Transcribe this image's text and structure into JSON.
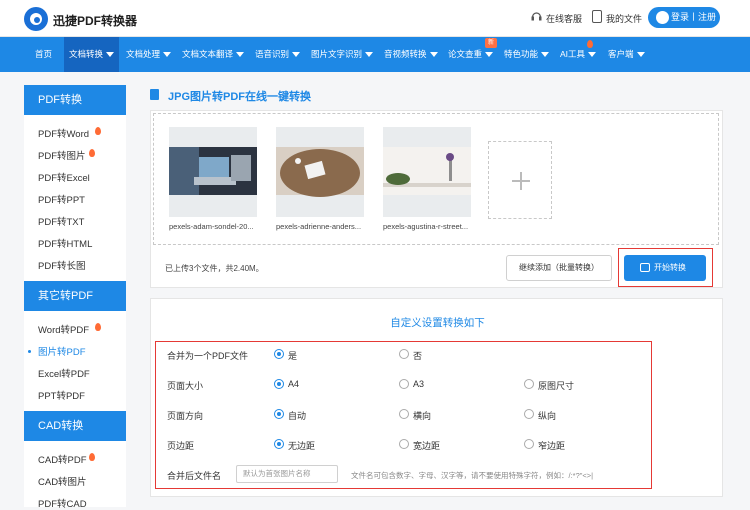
{
  "header": {
    "brand": "迅捷PDF转换器",
    "service": "在线客服",
    "my_files": "我的文件",
    "login": "登录丨注册"
  },
  "nav": {
    "items": [
      {
        "label": "首页",
        "caret": false
      },
      {
        "label": "文档转换",
        "caret": true
      },
      {
        "label": "文档处理",
        "caret": true
      },
      {
        "label": "文档文本翻译",
        "caret": true
      },
      {
        "label": "语音识别",
        "caret": true
      },
      {
        "label": "图片文字识别",
        "caret": true
      },
      {
        "label": "音视频转换",
        "caret": true
      },
      {
        "label": "论文查重",
        "caret": true
      },
      {
        "label": "特色功能",
        "caret": true
      },
      {
        "label": "AI工具",
        "caret": true
      },
      {
        "label": "客户端",
        "caret": true
      }
    ],
    "new_badge": "新"
  },
  "sidebar": {
    "sections": [
      {
        "title": "PDF转换",
        "items": [
          "PDF转Word",
          "PDF转图片",
          "PDF转Excel",
          "PDF转PPT",
          "PDF转TXT",
          "PDF转HTML",
          "PDF转长图"
        ]
      },
      {
        "title": "其它转PDF",
        "items": [
          "Word转PDF",
          "图片转PDF",
          "Excel转PDF",
          "PPT转PDF"
        ]
      },
      {
        "title": "CAD转换",
        "items": [
          "CAD转PDF",
          "CAD转图片",
          "PDF转CAD"
        ]
      }
    ]
  },
  "page": {
    "title": "JPG图片转PDF在线一键转换"
  },
  "upload": {
    "files": [
      {
        "name": "pexels-adam-sondel-20..."
      },
      {
        "name": "pexels-adrienne-anders..."
      },
      {
        "name": "pexels-agustina-r-street..."
      }
    ],
    "status": "已上传3个文件，共2.40M。",
    "add_more": "继续添加（批量转换）",
    "start": "开始转换"
  },
  "settings": {
    "title": "自定义设置转换如下",
    "rows": [
      {
        "label": "合并为一个PDF文件",
        "options": [
          "是",
          "否"
        ],
        "selected": 0
      },
      {
        "label": "页面大小",
        "options": [
          "A4",
          "A3",
          "原图尺寸"
        ],
        "selected": 0
      },
      {
        "label": "页面方向",
        "options": [
          "自动",
          "横向",
          "纵向"
        ],
        "selected": 0
      },
      {
        "label": "页边距",
        "options": [
          "无边距",
          "宽边距",
          "窄边距"
        ],
        "selected": 0
      }
    ],
    "filename_label": "合并后文件名",
    "filename_placeholder": "默认为首张图片名称",
    "filename_hint": "文件名可包含数字、字母、汉字等，请不要使用特殊字符，例如：/:*?\"<>|"
  },
  "colors": {
    "primary": "#1e88e5",
    "highlight": "#e53935",
    "hot": "#ff6b35"
  }
}
